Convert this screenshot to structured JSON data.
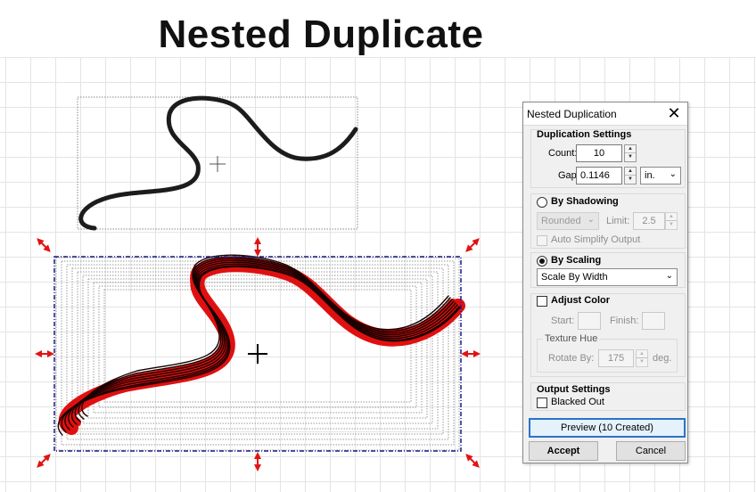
{
  "title": "Nested Duplicate",
  "dialog": {
    "title": "Nested Duplication",
    "close_glyph": "✕",
    "duplication": {
      "heading": "Duplication Settings",
      "count_label": "Count:",
      "count_value": "10",
      "gap_label": "Gap:",
      "gap_value": "0.1146",
      "unit": "in."
    },
    "shadowing": {
      "label": "By Shadowing",
      "selected": false,
      "corner": "Rounded",
      "limit_label": "Limit:",
      "limit_value": "2.5",
      "auto_simplify": "Auto Simplify Output"
    },
    "scaling": {
      "label": "By Scaling",
      "selected": true,
      "mode": "Scale By Width"
    },
    "color": {
      "label": "Adjust Color",
      "start_label": "Start:",
      "finish_label": "Finish:",
      "texture_heading": "Texture Hue",
      "rotate_label": "Rotate By:",
      "rotate_value": "175",
      "rotate_unit": "deg."
    },
    "output": {
      "heading": "Output Settings",
      "blacked_out": "Blacked Out"
    },
    "preview_button": "Preview (10 Created)",
    "accept_button": "Accept",
    "cancel_button": "Cancel"
  },
  "icons": {
    "spin_up": "▲",
    "spin_down": "▼",
    "dropdown": "⌄"
  },
  "colors": {
    "curve": "#1c1c1c",
    "duplicate_fill": "#e01010",
    "duplicate_stroke": "#1a0000",
    "handle": "#e01313",
    "selection": "#1a1a8a",
    "focus": "#2a73c8"
  }
}
